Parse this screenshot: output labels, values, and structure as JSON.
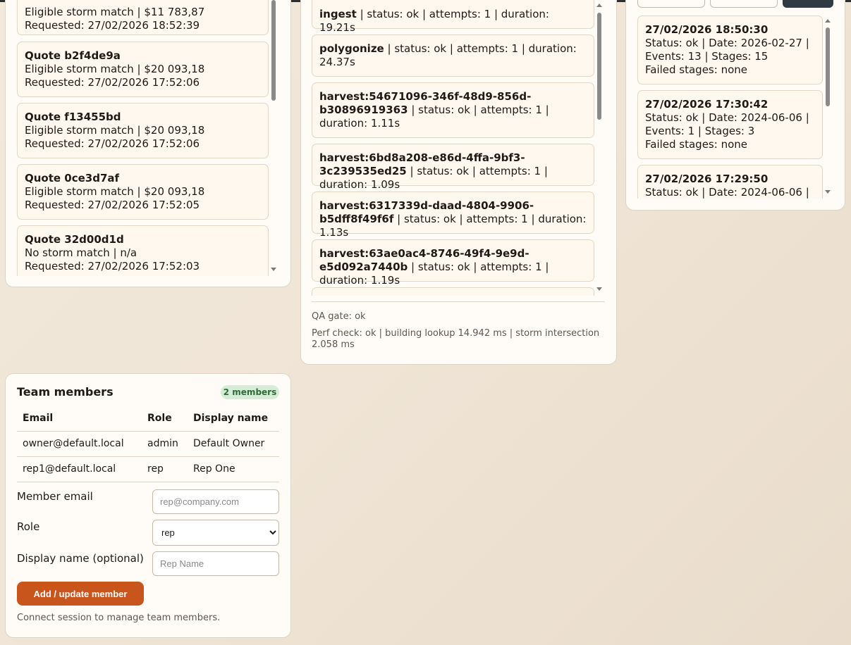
{
  "quotes": [
    {
      "title": "",
      "line1": "Eligible storm match | $11 783,87",
      "line2": "Requested: 27/02/2026 18:52:39"
    },
    {
      "title": "Quote b2f4de9a",
      "line1": "Eligible storm match | $20 093,18",
      "line2": "Requested: 27/02/2026 17:52:06"
    },
    {
      "title": "Quote f13455bd",
      "line1": "Eligible storm match | $20 093,18",
      "line2": "Requested: 27/02/2026 17:52:06"
    },
    {
      "title": "Quote 0ce3d7af",
      "line1": "Eligible storm match | $20 093,18",
      "line2": "Requested: 27/02/2026 17:52:05"
    },
    {
      "title": "Quote 32d00d1d",
      "line1": "No storm match | n/a",
      "line2": "Requested: 27/02/2026 17:52:03"
    }
  ],
  "stages": [
    {
      "name": "ingest",
      "details": " | status: ok | attempts: 1 | duration: 19.21s"
    },
    {
      "name": "polygonize",
      "details": " | status: ok | attempts: 1 | duration: 24.37s"
    },
    {
      "name": "harvest:54671096-346f-48d9-856d-b30896919363",
      "details": " | status: ok | attempts: 1 | duration: 1.11s"
    },
    {
      "name": "harvest:6bd8a208-e86d-4ffa-9bf3-3c239535ed25",
      "details": " | status: ok | attempts: 1 | duration: 1.09s"
    },
    {
      "name": "harvest:6317339d-daad-4804-9906-b5dff8f49f6f",
      "details": " | status: ok | attempts: 1 | duration: 1.13s"
    },
    {
      "name": "harvest:63ae0ac4-8746-49f4-9e9d-e5d092a7440b",
      "details": " | status: ok | attempts: 1 | duration: 1.19s"
    }
  ],
  "pipeline": {
    "qa_gate": "QA gate: ok",
    "perf_check": "Perf check: ok | building lookup 14.942 ms | storm intersection 2.058 ms"
  },
  "runs": [
    {
      "timestamp": "27/02/2026 18:50:30",
      "line1": "Status: ok | Date: 2026-02-27 |",
      "line2": "Events: 13 | Stages: 15",
      "line3": "Failed stages: none"
    },
    {
      "timestamp": "27/02/2026 17:30:42",
      "line1": "Status: ok | Date: 2024-06-06 |",
      "line2": "Events: 1 | Stages: 3",
      "line3": "Failed stages: none"
    },
    {
      "timestamp": "27/02/2026 17:29:50",
      "line1": "Status: ok | Date: 2024-06-06 |",
      "line2": "",
      "line3": ""
    }
  ],
  "team": {
    "title": "Team members",
    "badge": "2 members",
    "columns": {
      "email": "Email",
      "role": "Role",
      "display_name": "Display name"
    },
    "rows": [
      {
        "email": "owner@default.local",
        "role": "admin",
        "display_name": "Default Owner"
      },
      {
        "email": "rep1@default.local",
        "role": "rep",
        "display_name": "Rep One"
      }
    ],
    "form": {
      "email_label": "Member email",
      "email_placeholder": "rep@company.com",
      "role_label": "Role",
      "role_value": "rep",
      "display_label": "Display name (optional)",
      "display_placeholder": "Rep Name",
      "submit_label": "Add / update member"
    },
    "hint": "Connect session to manage team members."
  },
  "colors": {
    "accent": "#c8561c",
    "badge_bg": "#d6ecd6",
    "badge_text": "#2e6b37",
    "panel_bg": "#fffcf7",
    "card_bg": "#fff8ee"
  }
}
